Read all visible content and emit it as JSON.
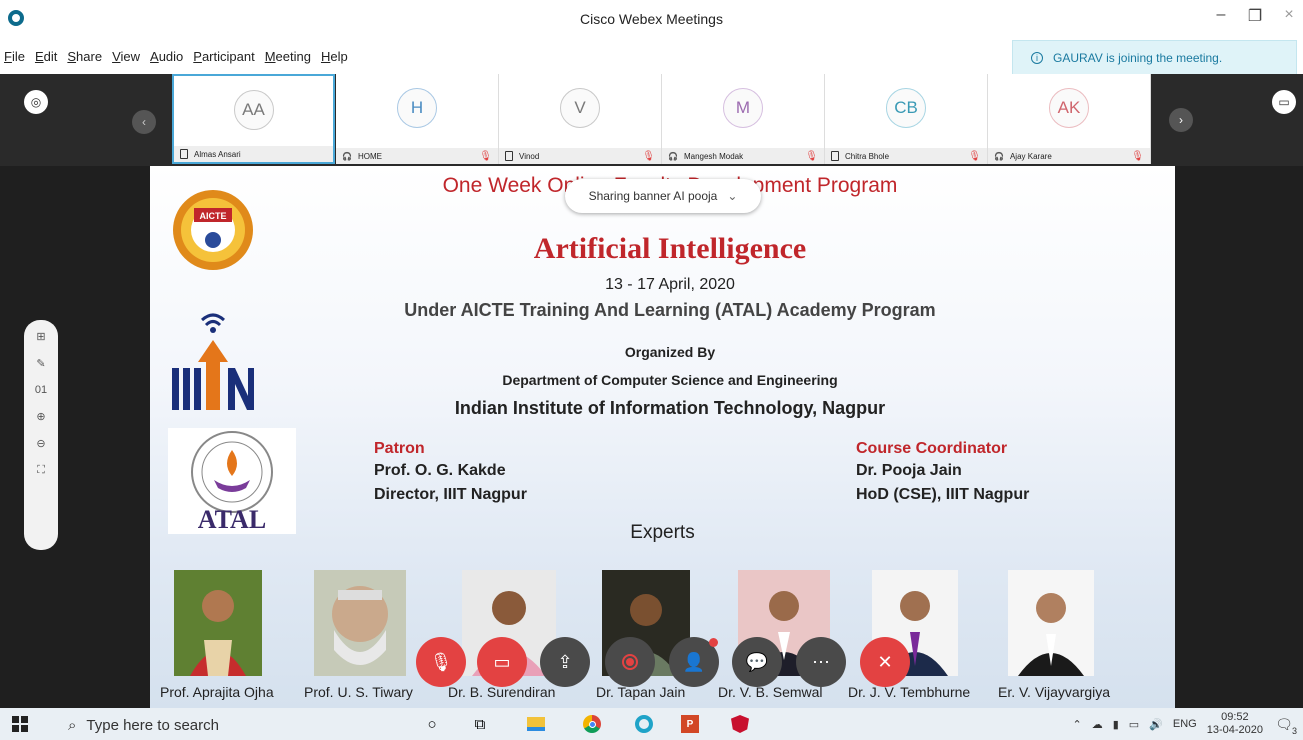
{
  "window": {
    "title": "Cisco Webex Meetings"
  },
  "menu": [
    {
      "first": "F",
      "rest": "ile"
    },
    {
      "first": "E",
      "rest": "dit"
    },
    {
      "first": "S",
      "rest": "hare"
    },
    {
      "first": "V",
      "rest": "iew"
    },
    {
      "first": "A",
      "rest": "udio"
    },
    {
      "first": "P",
      "rest": "articipant"
    },
    {
      "first": "M",
      "rest": "eeting"
    },
    {
      "first": "H",
      "rest": "elp"
    }
  ],
  "notification": "GAURAV is joining the meeting.",
  "participants": [
    {
      "initials": "AA",
      "name": "Almas Ansari",
      "color": "#777"
    },
    {
      "initials": "H",
      "name": "HOME",
      "color": "#4a8cc2"
    },
    {
      "initials": "V",
      "name": "Vinod",
      "color": "#777"
    },
    {
      "initials": "M",
      "name": "Mangesh Modak",
      "color": "#9c6bb0"
    },
    {
      "initials": "CB",
      "name": "Chitra Bhole",
      "color": "#3a9ab5"
    },
    {
      "initials": "AK",
      "name": "Ajay Karare",
      "color": "#d0666e"
    }
  ],
  "side_toolbar": {
    "page": "01"
  },
  "share_banner": "Sharing banner AI pooja",
  "slide": {
    "program_title": "One Week Online Faculty Development Program",
    "on": "on",
    "subject": "Artificial Intelligence",
    "dates": "13 - 17 April, 2020",
    "atal_line": "Under AICTE Training And Learning (ATAL) Academy Program",
    "organized_by": "Organized By",
    "department": "Department of Computer Science and Engineering",
    "institute": "Indian Institute of Information Technology, Nagpur",
    "patron_heading": "Patron",
    "patron_name": "Prof. O. G. Kakde",
    "patron_role": "Director, IIIT Nagpur",
    "coordinator_heading": "Course Coordinator",
    "coordinator_name": "Dr. Pooja Jain",
    "coordinator_role": "HoD (CSE), IIIT Nagpur",
    "experts_heading": "Experts",
    "aicte_logo_text": "AICTE",
    "iiitn_logo_text": "IIIN",
    "atal_logo_text": "ATAL",
    "experts": [
      "Prof. Aprajita Ojha",
      "Prof. U. S. Tiwary",
      "Dr. B. Surendiran",
      "Dr. Tapan Jain",
      "Dr. V. B. Semwal",
      "Dr. J. V. Tembhurne",
      "Er. V. Vijayvargiya"
    ]
  },
  "taskbar": {
    "search_placeholder": "Type here to search",
    "language": "ENG",
    "time": "09:52",
    "date": "13-04-2020",
    "notifications": "3"
  },
  "colors": {
    "accent": "#c0262b",
    "webex_blue": "#1a7aa0",
    "control_red": "#e34242"
  }
}
